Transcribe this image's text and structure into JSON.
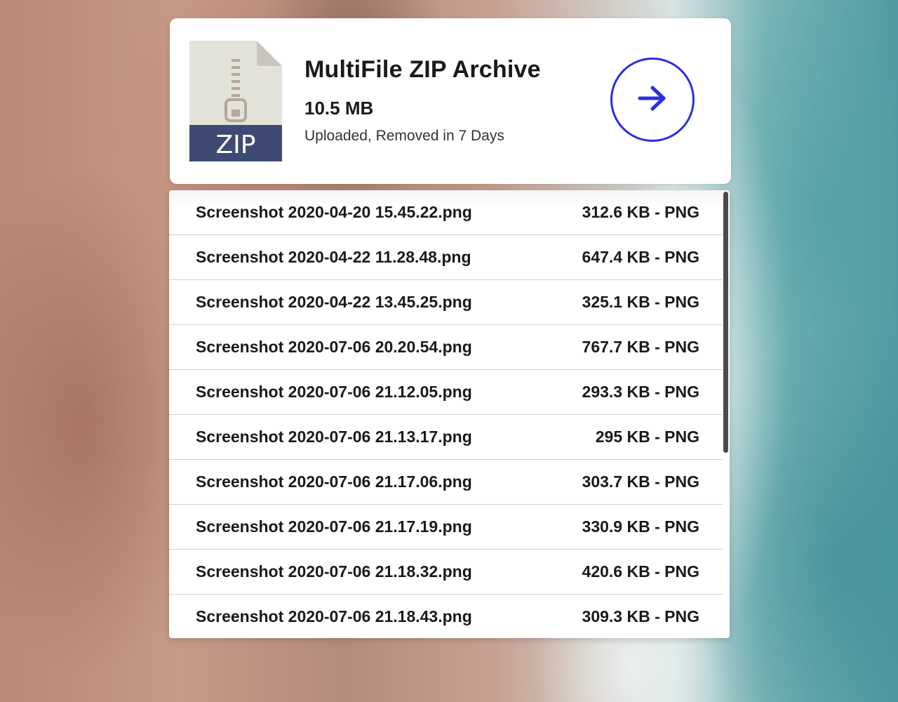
{
  "archive": {
    "title": "MultiFile ZIP Archive",
    "size": "10.5 MB",
    "status": "Uploaded, Removed in 7 Days",
    "icon_label": "ZIP",
    "icon": "zip-file-icon",
    "action_icon": "arrow-right-icon",
    "accent_color": "#2a2ee6"
  },
  "files": [
    {
      "name": "Screenshot 2020-04-20 15.45.22.png",
      "meta": "312.6 KB - PNG"
    },
    {
      "name": "Screenshot 2020-04-22 11.28.48.png",
      "meta": "647.4 KB - PNG"
    },
    {
      "name": "Screenshot 2020-04-22 13.45.25.png",
      "meta": "325.1 KB - PNG"
    },
    {
      "name": "Screenshot 2020-07-06 20.20.54.png",
      "meta": "767.7 KB - PNG"
    },
    {
      "name": "Screenshot 2020-07-06 21.12.05.png",
      "meta": "293.3 KB - PNG"
    },
    {
      "name": "Screenshot 2020-07-06 21.13.17.png",
      "meta": "295 KB - PNG"
    },
    {
      "name": "Screenshot 2020-07-06 21.17.06.png",
      "meta": "303.7 KB - PNG"
    },
    {
      "name": "Screenshot 2020-07-06 21.17.19.png",
      "meta": "330.9 KB - PNG"
    },
    {
      "name": "Screenshot 2020-07-06 21.18.32.png",
      "meta": "420.6 KB - PNG"
    },
    {
      "name": "Screenshot 2020-07-06 21.18.43.png",
      "meta": "309.3 KB - PNG"
    }
  ]
}
